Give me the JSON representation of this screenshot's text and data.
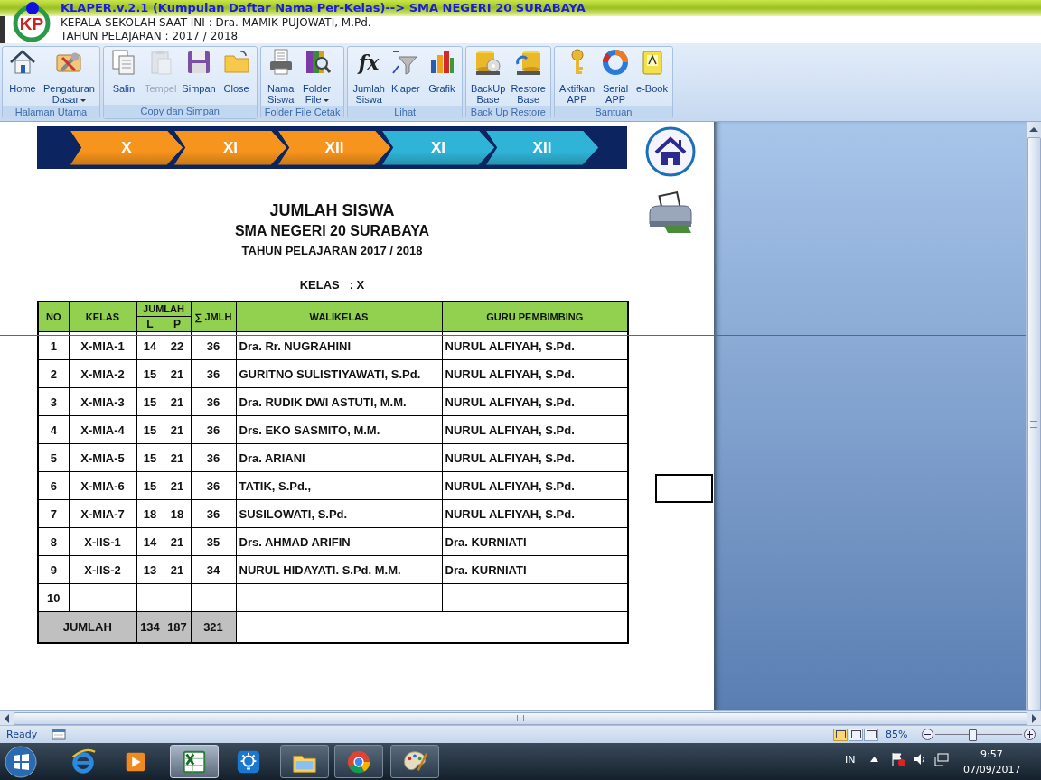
{
  "app": {
    "title": "KLAPER.v.2.1 (Kumpulan Daftar Nama Per-Kelas)--> SMA NEGERI 20 SURABAYA",
    "principal": "KEPALA SEKOLAH SAAT INI : Dra. MAMIK PUJOWATI, M.Pd.",
    "year": "TAHUN PELAJARAN : 2017 / 2018",
    "logo": "KP"
  },
  "ribbon": {
    "groups": [
      {
        "label": "Halaman Utama",
        "buttons": [
          {
            "lines": [
              "Home"
            ],
            "disabled": false,
            "dropdown": false
          },
          {
            "lines": [
              "Pengaturan",
              "Dasar"
            ],
            "disabled": false,
            "dropdown": true
          }
        ]
      },
      {
        "label": "Copy dan Simpan",
        "buttons": [
          {
            "lines": [
              "Salin"
            ],
            "disabled": false,
            "dropdown": false
          },
          {
            "lines": [
              "Tempel"
            ],
            "disabled": true,
            "dropdown": false
          },
          {
            "lines": [
              "Simpan"
            ],
            "disabled": false,
            "dropdown": false
          },
          {
            "lines": [
              "Close"
            ],
            "disabled": false,
            "dropdown": false
          }
        ]
      },
      {
        "label": "Folder File Cetak",
        "buttons": [
          {
            "lines": [
              "Nama",
              "Siswa"
            ],
            "disabled": false,
            "dropdown": false
          },
          {
            "lines": [
              "Folder",
              "File"
            ],
            "disabled": false,
            "dropdown": true
          }
        ]
      },
      {
        "label": "Lihat",
        "buttons": [
          {
            "lines": [
              "Jumlah",
              "Siswa"
            ],
            "disabled": false,
            "dropdown": false,
            "glyph": "fx"
          },
          {
            "lines": [
              "Klaper"
            ],
            "disabled": false,
            "dropdown": false
          },
          {
            "lines": [
              "Grafik"
            ],
            "disabled": false,
            "dropdown": false
          }
        ]
      },
      {
        "label": "Back Up Restore",
        "buttons": [
          {
            "lines": [
              "BackUp",
              "Base"
            ],
            "disabled": false,
            "dropdown": false
          },
          {
            "lines": [
              "Restore",
              "Base"
            ],
            "disabled": false,
            "dropdown": false
          }
        ]
      },
      {
        "label": "Bantuan",
        "buttons": [
          {
            "lines": [
              "Aktifkan",
              "APP"
            ],
            "disabled": false,
            "dropdown": false
          },
          {
            "lines": [
              "Serial",
              "APP"
            ],
            "disabled": false,
            "dropdown": false
          },
          {
            "lines": [
              "e-Book"
            ],
            "disabled": false,
            "dropdown": false
          }
        ]
      }
    ]
  },
  "class_nav": [
    {
      "label": "X",
      "color": "#f7941d"
    },
    {
      "label": "XI",
      "color": "#f7941d"
    },
    {
      "label": "XII",
      "color": "#f7941d"
    },
    {
      "label": "XI",
      "color": "#2fb4d8"
    },
    {
      "label": "XII",
      "color": "#2fb4d8"
    }
  ],
  "report": {
    "title": "JUMLAH SISWA",
    "school": "SMA NEGERI 20 SURABAYA",
    "year": "TAHUN PELAJARAN 2017 / 2018",
    "class_label": "KELAS   : X"
  },
  "table": {
    "columns": {
      "no": "NO",
      "kelas": "KELAS",
      "jumlah": "JUMLAH",
      "l": "L",
      "p": "P",
      "total": "∑ JMLH",
      "walikelas": "WALIKELAS",
      "guru": "GURU PEMBIMBING"
    },
    "rows": [
      {
        "no": "1",
        "kelas": "X-MIA-1",
        "l": "14",
        "p": "22",
        "total": "36",
        "walikelas": "Dra. Rr. NUGRAHINI",
        "guru": "NURUL ALFIYAH, S.Pd."
      },
      {
        "no": "2",
        "kelas": "X-MIA-2",
        "l": "15",
        "p": "21",
        "total": "36",
        "walikelas": "GURITNO SULISTIYAWATI, S.Pd.",
        "guru": "NURUL ALFIYAH, S.Pd."
      },
      {
        "no": "3",
        "kelas": "X-MIA-3",
        "l": "15",
        "p": "21",
        "total": "36",
        "walikelas": "Dra. RUDIK DWI ASTUTI, M.M.",
        "guru": "NURUL ALFIYAH, S.Pd."
      },
      {
        "no": "4",
        "kelas": "X-MIA-4",
        "l": "15",
        "p": "21",
        "total": "36",
        "walikelas": "Drs. EKO SASMITO, M.M.",
        "guru": "NURUL ALFIYAH, S.Pd."
      },
      {
        "no": "5",
        "kelas": "X-MIA-5",
        "l": "15",
        "p": "21",
        "total": "36",
        "walikelas": "Dra. ARIANI",
        "guru": "NURUL ALFIYAH, S.Pd."
      },
      {
        "no": "6",
        "kelas": "X-MIA-6",
        "l": "15",
        "p": "21",
        "total": "36",
        "walikelas": "TATIK, S.Pd.,",
        "guru": "NURUL ALFIYAH, S.Pd."
      },
      {
        "no": "7",
        "kelas": "X-MIA-7",
        "l": "18",
        "p": "18",
        "total": "36",
        "walikelas": "SUSILOWATI, S.Pd.",
        "guru": "NURUL ALFIYAH, S.Pd."
      },
      {
        "no": "8",
        "kelas": "X-IIS-1",
        "l": "14",
        "p": "21",
        "total": "35",
        "walikelas": "Drs. AHMAD ARIFIN",
        "guru": "Dra. KURNIATI"
      },
      {
        "no": "9",
        "kelas": "X-IIS-2",
        "l": "13",
        "p": "21",
        "total": "34",
        "walikelas": "NURUL HIDAYATI. S.Pd. M.M.",
        "guru": "Dra. KURNIATI"
      },
      {
        "no": "10"
      }
    ],
    "footer": {
      "label": "JUMLAH",
      "l": "134",
      "p": "187",
      "total": "321"
    }
  },
  "status_bar": {
    "status": "Ready",
    "views": [
      {
        "selected": true
      },
      {
        "selected": false
      },
      {
        "selected": false
      }
    ],
    "zoom": "85%",
    "zoom_slider": {
      "level": 0.43
    }
  },
  "taskbar": {
    "apps": [
      {
        "running": false,
        "selected": false
      },
      {
        "running": false,
        "selected": false
      },
      {
        "running": true,
        "selected": true
      },
      {
        "running": false,
        "selected": false
      },
      {
        "running": true,
        "selected": false
      },
      {
        "running": true,
        "selected": false
      },
      {
        "running": true,
        "selected": false
      }
    ],
    "language": "IN",
    "time": "9:57",
    "date": "07/09/2017"
  }
}
